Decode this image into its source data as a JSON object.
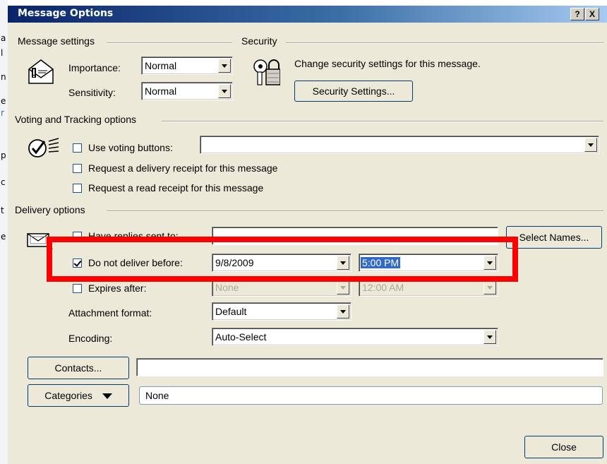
{
  "window": {
    "title": "Message Options",
    "help_button": "?",
    "close_button": "X"
  },
  "left_strip_letters": [
    "a",
    "l",
    "n",
    "e",
    "r",
    "p",
    "c",
    "t",
    "e"
  ],
  "message_settings": {
    "group_title": "Message settings",
    "importance": {
      "label": "Importance:",
      "value": "Normal"
    },
    "sensitivity": {
      "label": "Sensitivity:",
      "value": "Normal"
    }
  },
  "security": {
    "group_title": "Security",
    "description": "Change security settings for this message.",
    "button_label": "Security Settings..."
  },
  "voting": {
    "group_title": "Voting and Tracking options",
    "use_voting_buttons": {
      "label": "Use voting buttons:",
      "checked": false,
      "value": ""
    },
    "delivery_receipt": {
      "label": "Request a delivery receipt for this message",
      "checked": false
    },
    "read_receipt": {
      "label": "Request a read receipt for this message",
      "checked": false
    }
  },
  "delivery": {
    "group_title": "Delivery options",
    "have_replies": {
      "label": "Have replies sent to:",
      "checked": false,
      "value": ""
    },
    "select_names_button": "Select Names...",
    "do_not_deliver": {
      "label": "Do not deliver before:",
      "checked": true,
      "date": "9/8/2009",
      "time": "5:00 PM"
    },
    "expires": {
      "label": "Expires after:",
      "checked": false,
      "date": "None",
      "time": "12:00 AM"
    },
    "attachment_format": {
      "label": "Attachment format:",
      "value": "Default"
    },
    "encoding": {
      "label": "Encoding:",
      "value": "Auto-Select"
    }
  },
  "contacts": {
    "button_label": "Contacts...",
    "value": ""
  },
  "categories": {
    "button_label": "Categories",
    "value": "None"
  },
  "close_button": "Close",
  "highlight_color": "#ff0000"
}
